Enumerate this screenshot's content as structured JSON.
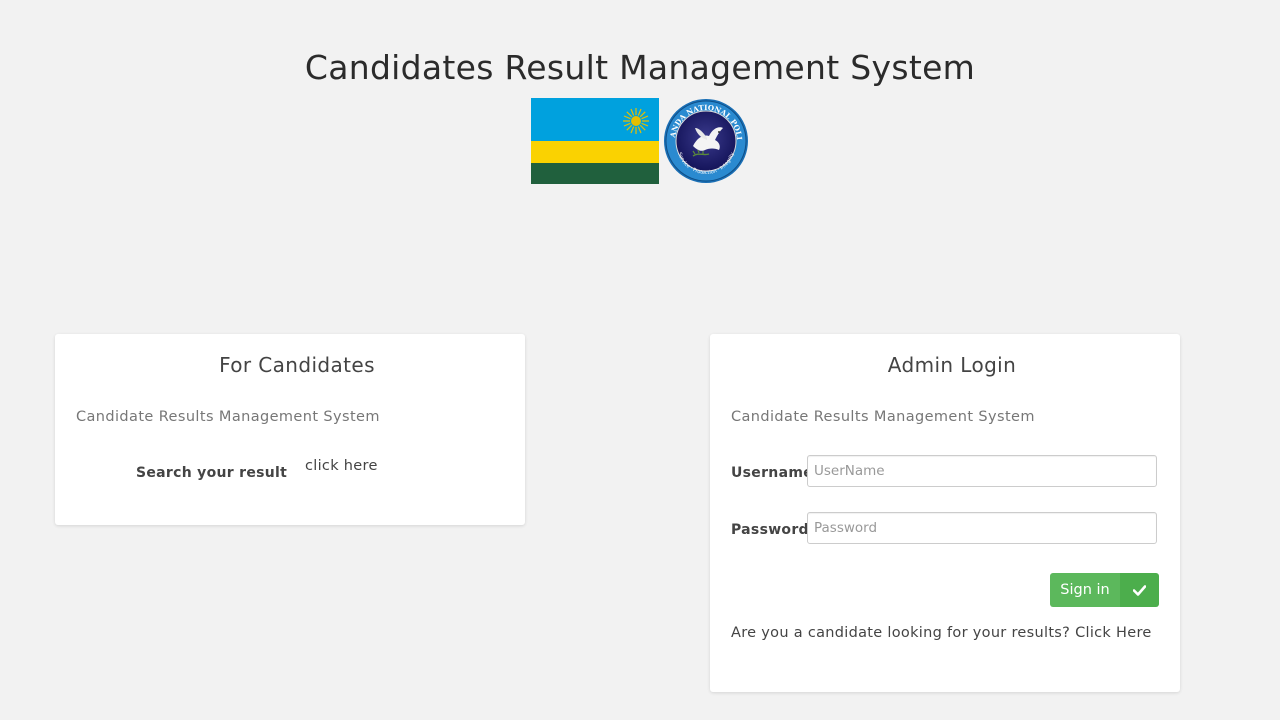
{
  "header": {
    "title": "Candidates Result Management System"
  },
  "logos": {
    "flag_icon": "rwanda-flag",
    "seal_icon": "rwanda-national-police-seal",
    "seal_text": "RWANDA NATIONAL POLICE",
    "seal_motto": "Service · Protection · Integrity"
  },
  "candidates_card": {
    "title": "For Candidates",
    "subtitle": "Candidate Results Management System",
    "search_label": "Search your result",
    "link_label": "click here"
  },
  "admin_card": {
    "title": "Admin Login",
    "subtitle": "Candidate Results Management System",
    "username_label": "Username",
    "username_value": "",
    "username_placeholder": "UserName",
    "password_label": "Password",
    "password_value": "",
    "password_placeholder": "Password",
    "signin_label": "Sign in",
    "signin_icon": "check-icon",
    "footer_prompt": "Are you a candidate looking for your results?",
    "footer_link": "Click Here"
  },
  "colors": {
    "background": "#f2f2f2",
    "button_green": "#5cb85c",
    "button_green_dark": "#4cae4c",
    "flag_blue": "#00a1de",
    "flag_yellow": "#fad201",
    "flag_green": "#20603d"
  }
}
